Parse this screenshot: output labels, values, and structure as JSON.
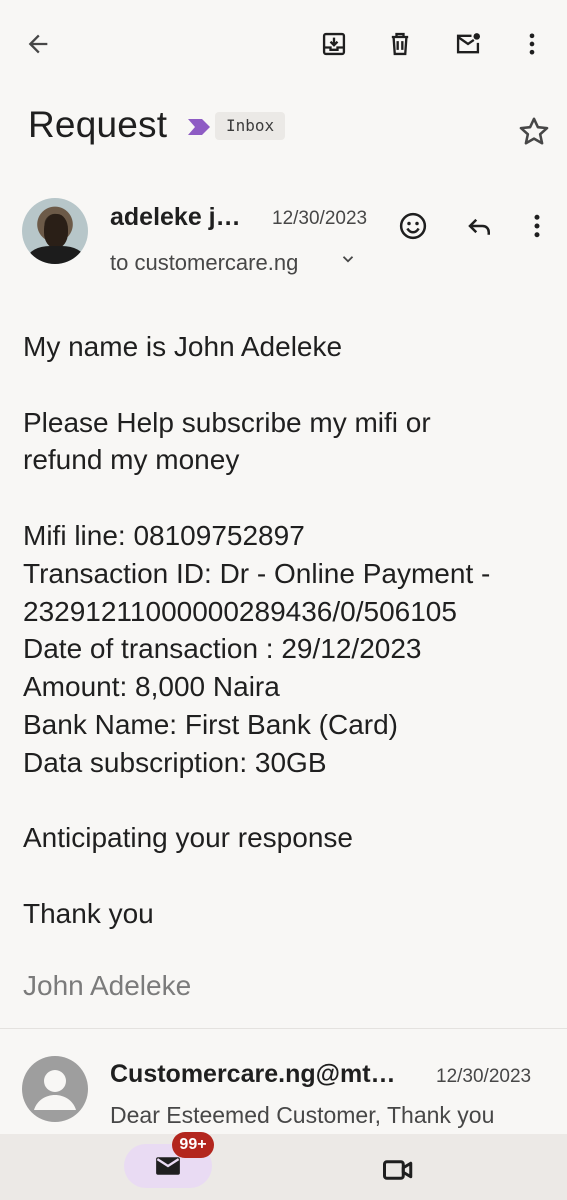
{
  "toolbar": {
    "back_icon": "arrow-back-icon",
    "archive_icon": "archive-icon",
    "delete_icon": "trash-icon",
    "mark_unread_icon": "mark-unread-icon",
    "more_icon": "more-vert-icon"
  },
  "subject": {
    "title": "Request",
    "label": "Inbox",
    "label_color": "#8e5cc4"
  },
  "message": {
    "sender_name": "adeleke j…",
    "date": "12/30/2023",
    "recipient": "to customercare.ng",
    "body": [
      "My name is John Adeleke",
      "",
      "Please Help subscribe my mifi or",
      "refund my money",
      "",
      "Mifi line: 08109752897",
      "Transaction ID: Dr - Online Payment -",
      "232912110000002894​36/0/506105",
      "Date of transaction : 29/12/2023",
      "Amount: 8,000 Naira",
      "Bank Name: First Bank (Card)",
      "Data subscription: 30GB",
      "",
      "Anticipating your response",
      "",
      "Thank you"
    ],
    "signature": "John Adeleke"
  },
  "reply": {
    "sender_name": "Customercare.ng@mt…",
    "date": "12/30/2023",
    "snippet": "Dear Esteemed Customer, Thank you"
  },
  "bottom_nav": {
    "mail_badge": "99+",
    "accent": "#e9dbf3",
    "badge_color": "#b3261e"
  }
}
